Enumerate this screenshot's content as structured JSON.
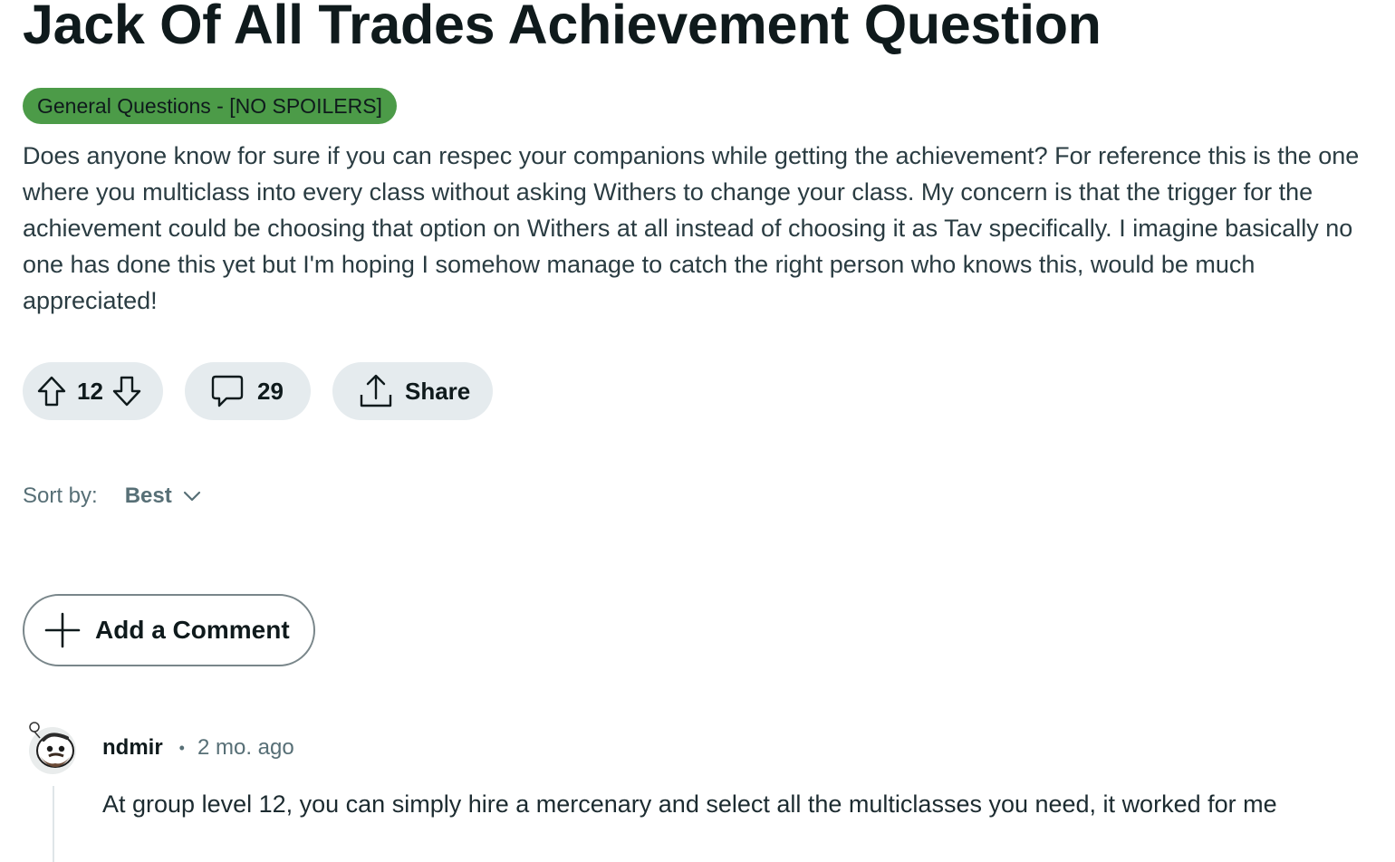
{
  "post": {
    "title": "Jack Of All Trades Achievement Question",
    "flair": "General Questions - [NO SPOILERS]",
    "flair_color": "#4c9b48",
    "body": "Does anyone know for sure if you can respec your companions while getting the achievement? For reference this is the one where you multiclass into every class without asking Withers to change your class. My concern is that the trigger for the achievement could be choosing that option on Withers at all instead of choosing it as Tav specifically. I imagine basically no one has done this yet but I'm hoping I somehow manage to catch the right person who knows this, would be much appreciated!"
  },
  "actions": {
    "upvote_icon": "upvote-arrow-icon",
    "downvote_icon": "downvote-arrow-icon",
    "vote_count": "12",
    "comment_icon": "speech-bubble-icon",
    "comment_count": "29",
    "share_icon": "share-upload-icon",
    "share_label": "Share"
  },
  "sort": {
    "label": "Sort by:",
    "value": "Best"
  },
  "add_comment": {
    "icon": "plus-icon",
    "label": "Add a Comment"
  },
  "comments": [
    {
      "author": "ndmir",
      "separator": "•",
      "time": "2 mo. ago",
      "body": "At group level 12, you can simply hire a mercenary and select all the multiclasses you need, it worked for me"
    }
  ]
}
